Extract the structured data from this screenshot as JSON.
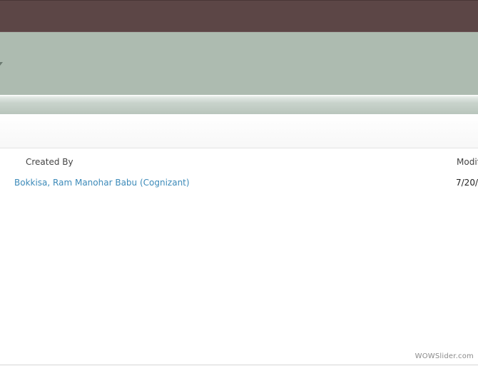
{
  "list": {
    "columns": {
      "created_by": "Created By",
      "modified": "Modif"
    },
    "rows": [
      {
        "created_by": "Bokkisa, Ram Manohar Babu (Cognizant)",
        "modified": "7/20/"
      }
    ]
  },
  "watermark": "WOWSlider.com",
  "colors": {
    "top_bar": "#5c4646",
    "ribbon": "#adbbb0",
    "link": "#3c8ab9"
  },
  "icons": {
    "ribbon_collapse": "chevron-down-icon"
  }
}
